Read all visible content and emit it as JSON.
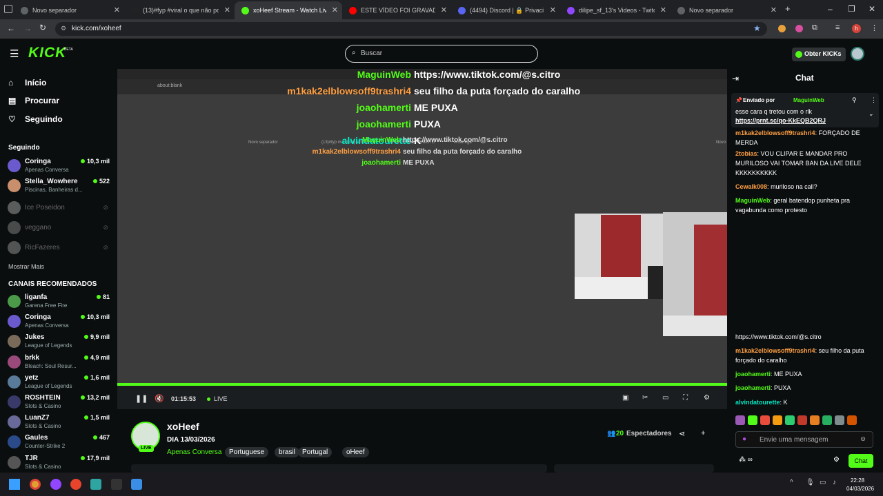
{
  "browser": {
    "tabs": [
      {
        "title": "Novo separador",
        "color": "#5f6368"
      },
      {
        "title": "(13)#fyp #viral o que não pode",
        "color": "#222"
      },
      {
        "title": "xoHeef Stream - Watch Live on",
        "color": "#53fc18"
      },
      {
        "title": "ESTE VÍDEO FOI GRAVADO E P",
        "color": "#ff0000"
      },
      {
        "title": "(4494) Discord | 🔒 Privaci",
        "color": "#5865f2"
      },
      {
        "title": "dilipe_sf_13's Videos - Twitch",
        "color": "#9146ff"
      },
      {
        "title": "Novo separador",
        "color": "#5f6368"
      }
    ],
    "url": "kick.com/xoheef"
  },
  "header": {
    "logo": "KICK",
    "beta": "BETA",
    "search_placeholder": "Buscar",
    "obter_label": "Obter KICKs"
  },
  "sidebar": {
    "nav": [
      {
        "label": "Início",
        "icon": "home-icon"
      },
      {
        "label": "Procurar",
        "icon": "browse-icon"
      },
      {
        "label": "Seguindo",
        "icon": "heart-icon"
      }
    ],
    "following_title": "Seguindo",
    "following": [
      {
        "name": "Coringa",
        "category": "Apenas Conversa",
        "viewers": "10,3 mil",
        "color": "#6a5acd"
      },
      {
        "name": "Stella_Wowhere",
        "category": "Piscinas, Banheiras d...",
        "viewers": "522",
        "color": "#c98e6b"
      }
    ],
    "offline": [
      {
        "name": "Ice Poseidon",
        "color": "#aaa"
      },
      {
        "name": "veggano",
        "color": "#888"
      },
      {
        "name": "RicFazeres",
        "color": "#999"
      }
    ],
    "show_more": "Mostrar Mais",
    "recommended_title": "CANAIS RECOMENDADOS",
    "recommended": [
      {
        "name": "liganfa",
        "category": "Garena Free Fire",
        "viewers": "81",
        "color": "#4a9a4a"
      },
      {
        "name": "Coringa",
        "category": "Apenas Conversa",
        "viewers": "10,3 mil",
        "color": "#6a5acd"
      },
      {
        "name": "Jukes",
        "category": "League of Legends",
        "viewers": "9,9 mil",
        "color": "#7a6a5a"
      },
      {
        "name": "brkk",
        "category": "Bleach: Soul Resur...",
        "viewers": "4,9 mil",
        "color": "#9a4a7a"
      },
      {
        "name": "yetz",
        "category": "League of Legends",
        "viewers": "1,6 mil",
        "color": "#5a7a9a"
      },
      {
        "name": "ROSHTEIN",
        "category": "Slots & Casino",
        "viewers": "13,2 mil",
        "color": "#3a3a6a"
      },
      {
        "name": "LuanZ7",
        "category": "Slots & Casino",
        "viewers": "1,5 mil",
        "color": "#6a6a9a"
      },
      {
        "name": "Gaules",
        "category": "Counter-Strike 2",
        "viewers": "467",
        "color": "#2a4a8a"
      },
      {
        "name": "TJR",
        "category": "Slots & Casino",
        "viewers": "17,9 mil",
        "color": "#555"
      }
    ]
  },
  "video": {
    "overlay": [
      {
        "user": "MaguinWeb",
        "msg": "https://www.tiktok.com/@s.citro",
        "ucolor": "#53fc18"
      },
      {
        "user": "m1kak2elblowsoff9trashri4",
        "msg": "seu filho da puta forçado do caralho",
        "ucolor": "#ff9f43"
      },
      {
        "user": "joaohamerti",
        "msg": "ME PUXA",
        "ucolor": "#53fc18"
      },
      {
        "user": "joaohamerti",
        "msg": "PUXA",
        "ucolor": "#53fc18"
      },
      {
        "user": "alvindatourette",
        "msg": "K",
        "ucolor": "#00e6c3"
      }
    ],
    "inner": [
      {
        "user": "MaguinWeb",
        "msg": "https://www.tiktok.com/@s.citro",
        "ucolor": "#53fc18"
      },
      {
        "user": "m1kak2elblowsoff9trashri4",
        "msg": "seu filho da puta forçado do caralho",
        "ucolor": "#ff9f43"
      },
      {
        "user": "joaohamerti",
        "msg": "ME PUXA",
        "ucolor": "#53fc18"
      }
    ],
    "inner_url": "about:blank",
    "inner_tabs": [
      "Novo separador",
      "(13)#fyp #viral o que não",
      "xoHeef Stream - Watch Li",
      "A carrega",
      "Novo separador"
    ],
    "time": "01:15:53",
    "live": "LIVE",
    "progress": 1.0
  },
  "stream": {
    "name": "xoHeef",
    "title": "DIA 13/03/2026",
    "category": "Apenas Conversa",
    "tags": [
      "Portuguese",
      "brasil",
      "Portugal",
      "oHeef"
    ],
    "viewers": "20",
    "viewers_label": "Espectadores",
    "live_badge": "LIVE"
  },
  "chat": {
    "title": "Chat",
    "pinned_by_label": "Enviado por",
    "pinned_by": "MaguinWeb",
    "pinned_text": "esse cara q tretou com o rlk",
    "pinned_link": "https://prnt.sc/qo-KkEQB2QRJ",
    "messages": [
      {
        "user": "m1kak2elblowsoff9trashri4",
        "text": "FORÇADO DE MERDA",
        "ucolor": "#ff9f43"
      },
      {
        "user": "2tobias",
        "text": "VOU CLIPAR E MANDAR PRO MURILOSO VAI TOMAR BAN DA LIVE DELE KKKKKKKKKK",
        "ucolor": "#ff9f43"
      },
      {
        "user": "Cewalk008",
        "text": "muriloso na call?",
        "ucolor": "#ff9f43"
      },
      {
        "user": "MaguinWeb",
        "text": "geral batendop punheta pra vagabunda como protesto",
        "ucolor": "#53fc18"
      }
    ],
    "messages_bottom": [
      {
        "user": "",
        "text": "https://www.tiktok.com/@s.citro",
        "ucolor": "#fff"
      },
      {
        "user": "m1kak2elblowsoff9trashri4",
        "text": "seu filho da puta forçado do caralho",
        "ucolor": "#ff9f43"
      },
      {
        "user": "joaohamerti",
        "text": "ME PUXA",
        "ucolor": "#53fc18"
      },
      {
        "user": "joaohamerti",
        "text": "PUXA",
        "ucolor": "#53fc18"
      },
      {
        "user": "alvindatourette",
        "text": "K",
        "ucolor": "#00e6c3"
      }
    ],
    "input_placeholder": "Envie uma mensagem",
    "send_label": "Chat"
  },
  "taskbar": {
    "time": "22:28",
    "date": "04/03/2026"
  }
}
